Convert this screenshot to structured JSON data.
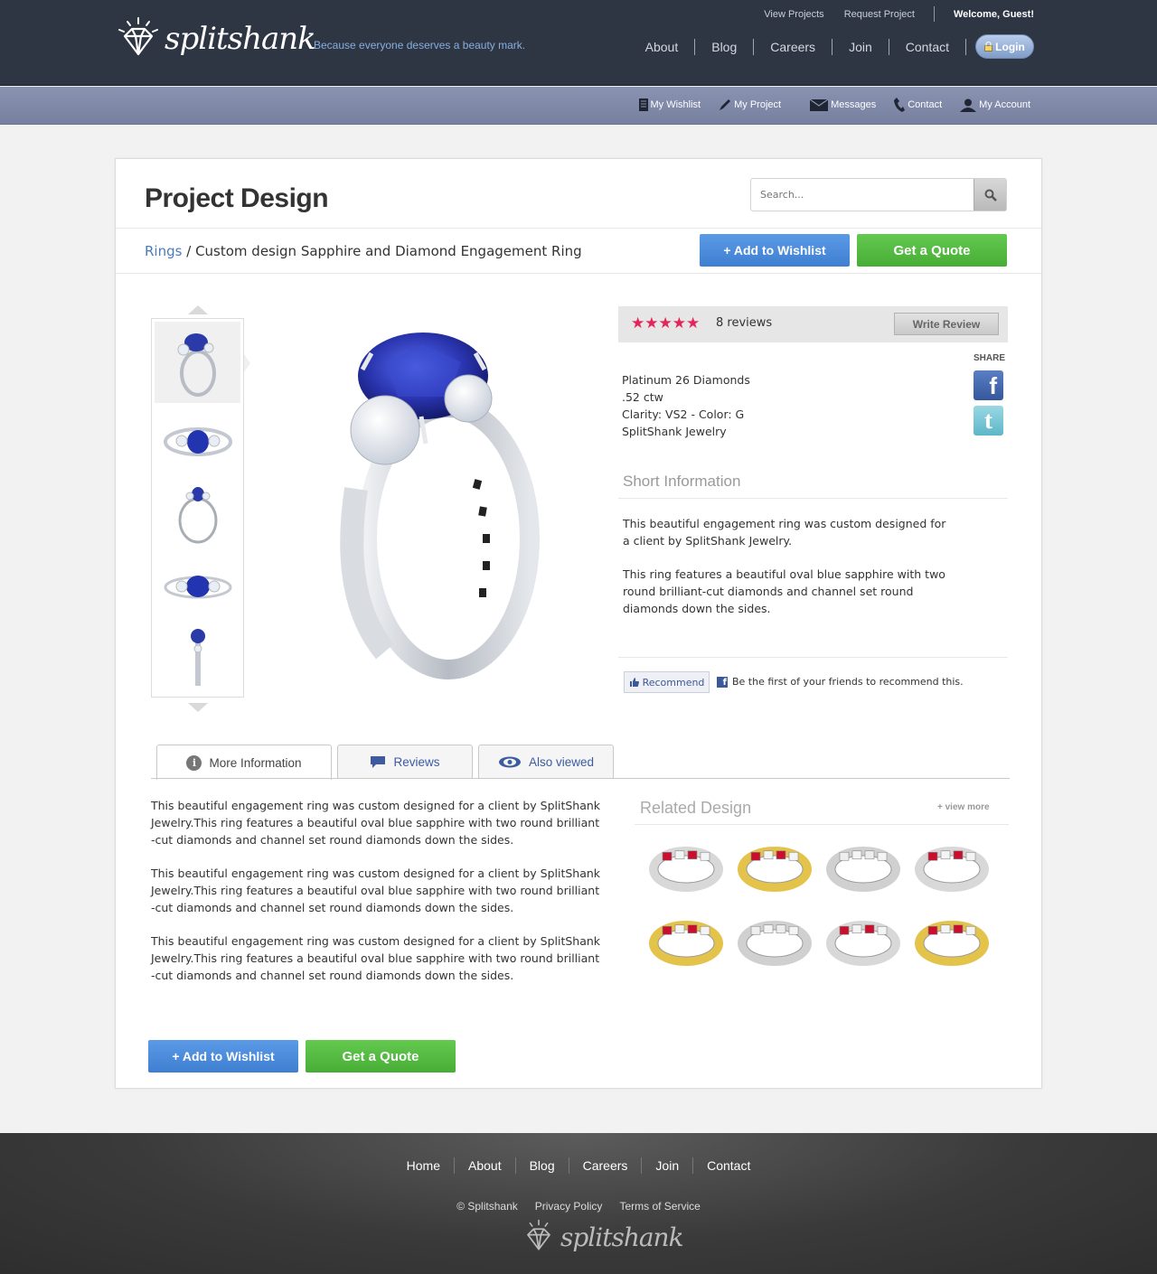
{
  "header": {
    "logo_text": "splitshank",
    "tagline": "Because everyone deserves a beauty mark.",
    "utility_links": [
      "View Projects",
      "Request Project"
    ],
    "welcome": "Welcome, Guest!",
    "nav": [
      "About",
      "Blog",
      "Careers",
      "Join",
      "Contact"
    ],
    "login_label": "Login"
  },
  "subnav": [
    {
      "label": "My Wishlist",
      "icon": "list-icon"
    },
    {
      "label": "My Project",
      "icon": "pencil-icon"
    },
    {
      "label": "Messages",
      "icon": "envelope-icon"
    },
    {
      "label": "Contact",
      "icon": "phone-icon"
    },
    {
      "label": "My Account",
      "icon": "user-icon"
    }
  ],
  "page": {
    "title": "Project Design",
    "search_placeholder": "Search...",
    "breadcrumb_link": "Rings",
    "breadcrumb_sep": "/",
    "breadcrumb_current": "Custom design Sapphire and Diamond Engagement Ring",
    "add_wishlist": "+ Add to Wishlist",
    "get_quote": "Get a Quote"
  },
  "product": {
    "stars": "★★★★★",
    "rating": 5,
    "reviews": "8 reviews",
    "write_review": "Write Review",
    "share_label": "SHARE",
    "specs": [
      "Platinum 26 Diamonds",
      ".52 ctw",
      "Clarity: VS2 - Color: G",
      "SplitShank Jewelry"
    ],
    "short_info_title": "Short Information",
    "short_info": [
      "This beautiful engagement ring was custom designed for a client by SplitShank Jewelry.",
      "This ring features a beautiful oval blue sapphire with two round brilliant-cut diamonds and channel set round diamonds down the sides."
    ],
    "recommend_label": "Recommend",
    "recommend_text": "Be the first of your friends to recommend this."
  },
  "tabs": [
    {
      "label": "More Information",
      "icon": "info-icon",
      "active": true
    },
    {
      "label": "Reviews",
      "icon": "speech-bubble-icon",
      "active": false
    },
    {
      "label": "Also viewed",
      "icon": "eye-icon",
      "active": false
    }
  ],
  "more_info": [
    "This beautiful engagement ring was custom designed for a client by SplitShank Jewelry.This ring features a beautiful oval blue sapphire with two round brilliant -cut diamonds and channel set round diamonds down the sides.",
    "This beautiful engagement ring was custom designed for a client by SplitShank Jewelry.This ring features a beautiful oval blue sapphire with two round brilliant -cut diamonds and channel set round diamonds down the sides.",
    "This beautiful engagement ring was custom designed for a client by SplitShank Jewelry.This ring features a beautiful oval blue sapphire with two round brilliant -cut diamonds and channel set round diamonds down the sides."
  ],
  "related": {
    "title": "Related Design",
    "view_more": "+ view more",
    "items": [
      {
        "metal": "#d8d8d8",
        "stone": "#c8102e"
      },
      {
        "metal": "#e4c34a",
        "stone": "#c8102e"
      },
      {
        "metal": "#d0d0d0",
        "stone": "#eeeeee"
      },
      {
        "metal": "#d8d8d8",
        "stone": "#c8102e"
      },
      {
        "metal": "#e4c34a",
        "stone": "#c8102e"
      },
      {
        "metal": "#d0d0d0",
        "stone": "#eeeeee"
      },
      {
        "metal": "#d8d8d8",
        "stone": "#c8102e"
      },
      {
        "metal": "#e4c34a",
        "stone": "#c8102e"
      }
    ]
  },
  "footer": {
    "nav": [
      "Home",
      "About",
      "Blog",
      "Careers",
      "Join",
      "Contact"
    ],
    "legal": [
      "© Splitshank",
      "Privacy Policy",
      "Terms of Service"
    ],
    "logo_text": "splitshank"
  },
  "colors": {
    "header_bg": "#2e3644",
    "subbar_bg": "#8a93b0",
    "accent_blue": "#4a88dc",
    "accent_green": "#55bb40",
    "star_red": "#e4245a",
    "sapphire": "#2a3aa8"
  }
}
